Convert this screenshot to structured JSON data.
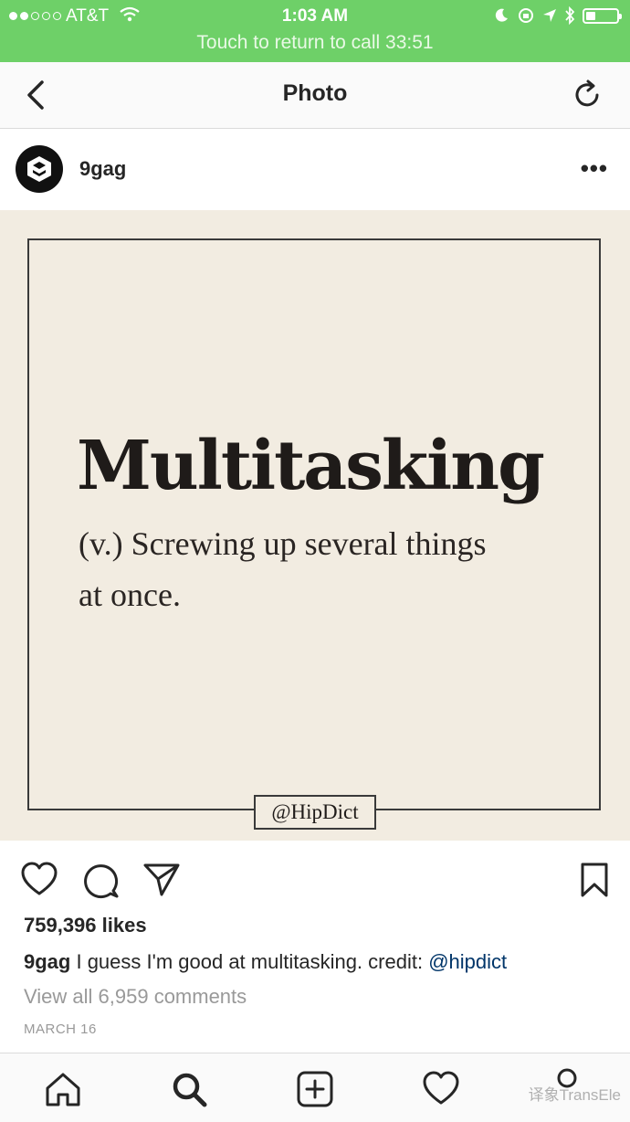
{
  "status_bar": {
    "carrier": "AT&T",
    "time": "1:03 AM",
    "call_banner": "Touch to return to call 33:51",
    "signal_filled": 2,
    "signal_total": 5
  },
  "nav": {
    "title": "Photo"
  },
  "post": {
    "username": "9gag",
    "image": {
      "word": "Multitasking",
      "definition_line1": "(v.) Screwing up several things",
      "definition_line2": "at once.",
      "credit": "@HipDict"
    },
    "likes": "759,396 likes",
    "caption_user": "9gag",
    "caption_text": " I guess I'm good at multitasking. credit: ",
    "caption_mention": "@hipdict",
    "view_comments": "View all 6,959 comments",
    "date": "MARCH 16"
  },
  "icons": {
    "back": "chevron-left-icon",
    "refresh": "refresh-icon",
    "more": "more-horizontal-icon",
    "like": "heart-icon",
    "comment": "comment-icon",
    "share": "send-icon",
    "save": "bookmark-icon",
    "home": "home-icon",
    "search": "search-icon",
    "add": "add-post-icon",
    "activity": "heart-icon",
    "profile": "profile-icon"
  },
  "watermark": "译象TransEle",
  "colors": {
    "status_bar": "#6ed068",
    "mention": "#003569",
    "photo_bg": "#f2ece1"
  }
}
